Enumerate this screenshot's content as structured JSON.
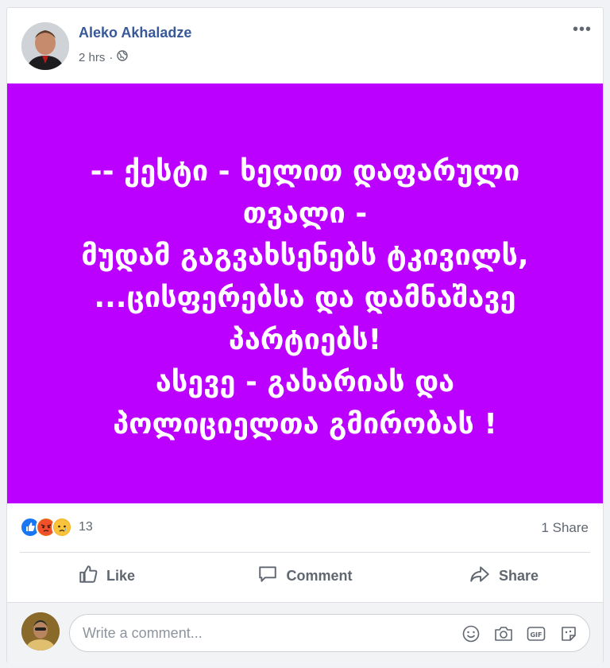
{
  "post": {
    "author": "Aleko Akhaladze",
    "time": "2 hrs",
    "privacy_icon": "globe-icon",
    "text": "-- ქესტი - ხელით დაფარული\nთვალი -\nმუდამ გაგვახსენებს ტკივილს,\n...ცისფერებსა და დამნაშავე\nპარტიებს!\nასევე - გახარიას და\nპოლიციელთა გმირობას !",
    "background_color": "#bb00ff"
  },
  "stats": {
    "reactions": [
      "like",
      "angry",
      "sad"
    ],
    "reaction_count": "13",
    "shares": "1 Share"
  },
  "actions": {
    "like": "Like",
    "comment": "Comment",
    "share": "Share"
  },
  "comment_box": {
    "placeholder": "Write a comment...",
    "icons": [
      "emoji-icon",
      "camera-icon",
      "gif-icon",
      "sticker-icon"
    ]
  }
}
